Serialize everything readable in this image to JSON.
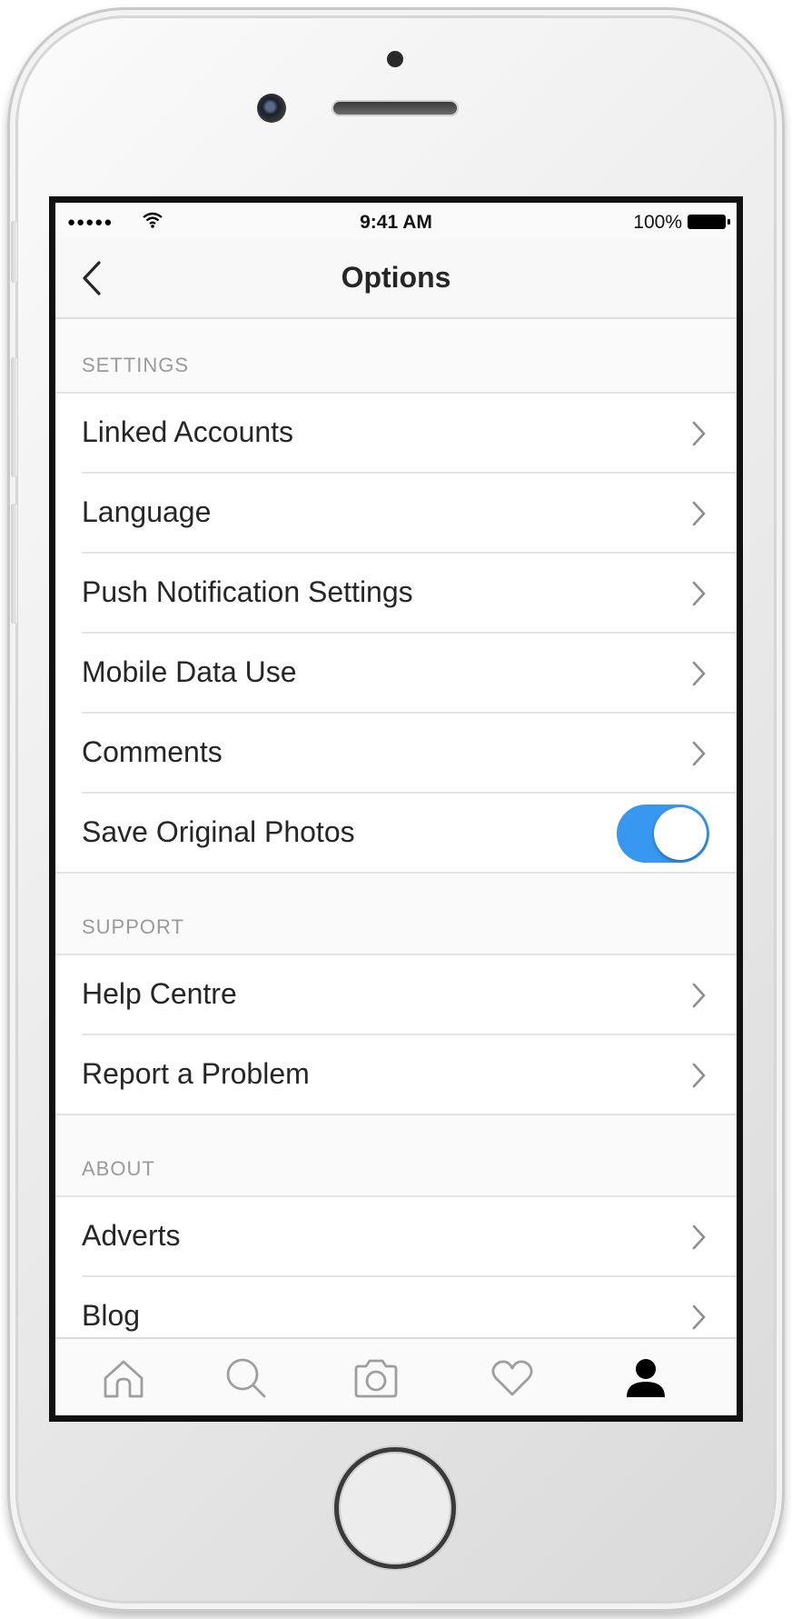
{
  "status_bar": {
    "signal": "●●●●●",
    "time": "9:41 AM",
    "battery": "100%"
  },
  "nav": {
    "title": "Options"
  },
  "sections": {
    "settings": {
      "header": "SETTINGS",
      "items": [
        "Linked Accounts",
        "Language",
        "Push Notification Settings",
        "Mobile Data Use",
        "Comments"
      ],
      "toggle_item": {
        "label": "Save Original Photos",
        "on": true
      }
    },
    "support": {
      "header": "SUPPORT",
      "items": [
        "Help Centre",
        "Report a Problem"
      ]
    },
    "about": {
      "header": "ABOUT",
      "items": [
        "Adverts",
        "Blog"
      ]
    }
  },
  "tab_bar": {
    "icons": [
      "home-icon",
      "search-icon",
      "camera-icon",
      "heart-icon",
      "profile-icon"
    ],
    "active": "profile-icon"
  },
  "colors": {
    "accent": "#3897f0",
    "text": "#262626",
    "section_header": "#9a9a9a",
    "background": "#fafafa"
  }
}
